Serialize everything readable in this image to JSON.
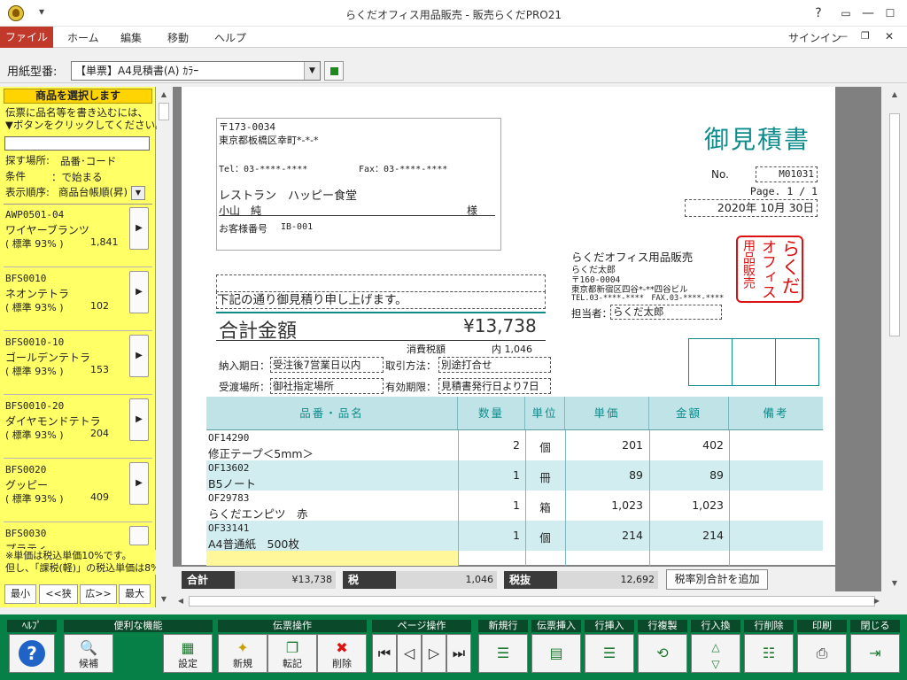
{
  "window": {
    "title": "らくだオフィス用品販売 - 販売らくだPRO21",
    "quick_access": "▾",
    "help_btn": "?",
    "restore_btn": "▭",
    "minimize_btn": "—",
    "maximize_btn": "☐",
    "close_btn": "✕",
    "signin": "サインイン"
  },
  "menu": {
    "file": "ファイル",
    "home": "ホーム",
    "edit": "編集",
    "move": "移動",
    "help": "ヘルプ"
  },
  "paper": {
    "label": "用紙型番:",
    "selected": "【単票】A4見積書(A) ｶﾗｰ"
  },
  "sidebar": {
    "header": "商品を選択します",
    "instruction1": "伝票に品名等を書き込むには、",
    "instruction2": "▼ボタンをクリックしてください。",
    "search_place_label": "探す場所:",
    "search_place_value": "品番･コード",
    "condition_label": "条件",
    "condition_value": "：で始まる",
    "order_label": "表示順序:",
    "order_value": "商品台帳順(昇)",
    "items": [
      {
        "code": "AWP0501-04",
        "name": "ワイヤーブランツ",
        "std": "( 標準 93% )",
        "price": "1,841"
      },
      {
        "code": "BFS0010",
        "name": "ネオンテトラ",
        "std": "( 標準 93% )",
        "price": "102"
      },
      {
        "code": "BFS0010-10",
        "name": "ゴールデンテトラ",
        "std": "( 標準 93% )",
        "price": "153"
      },
      {
        "code": "BFS0010-20",
        "name": "ダイヤモンドテトラ",
        "std": "( 標準 93% )",
        "price": "204"
      },
      {
        "code": "BFS0020",
        "name": "グッピー",
        "std": "( 標準 93% )",
        "price": "409"
      },
      {
        "code": "BFS0030",
        "name": "プラティ",
        "std": "",
        "price": ""
      }
    ],
    "note1": "※単価は税込単価10%です。",
    "note2": "但し、「課税(軽)」の税込単価は8%",
    "nav_min": "最小",
    "nav_narrow": "<<狭",
    "nav_wide": "広>>",
    "nav_max": "最大"
  },
  "doc": {
    "title": "御見積書",
    "no_label": "No.",
    "no_value": "M01031",
    "page": "Page. 1 / 1",
    "date": "2020年 10月 30日",
    "postal": "〒173-0034",
    "address": "東京都板橋区幸町*-*-*",
    "tel": "Tel：03-****-****",
    "fax": "Fax：03-****-****",
    "customer_name": "レストラン　ハッピー食堂",
    "contact": "小山　純",
    "honorific": "様",
    "customer_no_label": "お客様番号",
    "customer_no": "IB-001",
    "message": "下記の通り御見積り申し上げます。",
    "total_label": "合計金額",
    "total_value": "¥13,738",
    "tax_label": "消費税額",
    "tax_value": "内 1,046",
    "delivery_label": "納入期日：",
    "delivery_value": "受注後7営業日以内",
    "payment_label": "取引方法：",
    "payment_value": "別途打合せ",
    "place_label": "受渡場所：",
    "place_value": "御社指定場所",
    "validity_label": "有効期限：",
    "validity_value": "見積書発行日より7日",
    "company": "らくだオフィス用品販売",
    "company_rep": "らくだ太郎",
    "company_postal": "〒160-0004",
    "company_address": "東京都新宿区四谷*-**四谷ビル",
    "company_tel": "TEL.03-****-****　FAX.03-****-****",
    "staff_label": "担当者：",
    "staff_value": "らくだ太郎",
    "stamp_lines": [
      "用品販売",
      "オフィス",
      "らくだ"
    ],
    "table_headers": {
      "item": "品番・品名",
      "qty": "数量",
      "unit": "単位",
      "price": "単価",
      "amount": "金額",
      "note": "備考"
    },
    "rows": [
      {
        "code": "OF14290",
        "name": "修正テープ＜5mm＞",
        "qty": "2",
        "unit": "個",
        "price": "201",
        "amount": "402"
      },
      {
        "code": "OF13602",
        "name": "B5ノート",
        "qty": "1",
        "unit": "冊",
        "price": "89",
        "amount": "89"
      },
      {
        "code": "OF29783",
        "name": "らくだエンピツ　赤",
        "qty": "1",
        "unit": "箱",
        "price": "1,023",
        "amount": "1,023"
      },
      {
        "code": "OF33141",
        "name": "A4普通紙　500枚",
        "qty": "1",
        "unit": "個",
        "price": "214",
        "amount": "214"
      }
    ]
  },
  "totals": {
    "total_label": "合計",
    "total_value": "¥13,738",
    "tax_label": "税",
    "tax_value": "1,046",
    "pretax_label": "税抜",
    "pretax_value": "12,692",
    "add_button": "税率別合計を追加"
  },
  "toolbar": {
    "help_group": "ﾍﾙﾌﾟ",
    "util_group": "便利な機能",
    "util_suggest": "候補",
    "util_settings": "設定",
    "slip_group": "伝票操作",
    "slip_new": "新規",
    "slip_copy": "転記",
    "slip_delete": "削除",
    "page_group": "ページ操作",
    "newline_group": "新規行",
    "insert_slip_group": "伝票挿入",
    "insert_row_group": "行挿入",
    "dup_row_group": "行複製",
    "swap_row_group": "行入換",
    "del_row_group": "行削除",
    "print_group": "印刷",
    "close_group": "閉じる",
    "colors": {
      "green": "#078048",
      "dark": "#0a4a2a",
      "accent": "#c0392b"
    }
  }
}
